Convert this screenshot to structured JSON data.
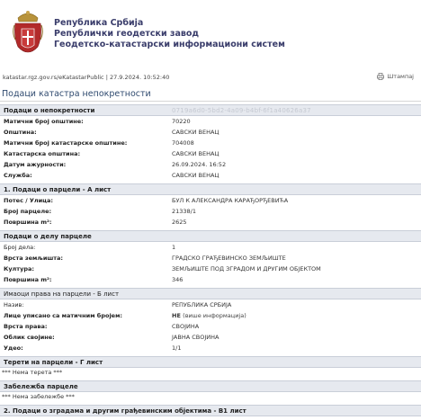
{
  "header": {
    "lines": [
      "Република Србија",
      "Републички геодетски завод",
      "Геодетско-катастарски информациони систем"
    ]
  },
  "urlbar": {
    "text": "katastar.rgz.gov.rs/eKatastarPublic | 27.9.2024. 10:52:40",
    "print_label": "Штампај"
  },
  "page_title": "Подаци катастра непокретности",
  "property": {
    "header": "Подаци о непокретности",
    "guid": "0719a6d0-5bd2-4a09-b4bf-6f1a40626a37",
    "rows": [
      {
        "k": "Матични број општине:",
        "v": "70220"
      },
      {
        "k": "Општина:",
        "v": "САВСКИ ВЕНАЦ"
      },
      {
        "k": "Матични број катастарске општине:",
        "v": "704008"
      },
      {
        "k": "Катастарска општина:",
        "v": "САВСКИ ВЕНАЦ"
      },
      {
        "k": "Датум ажурности:",
        "v": "26.09.2024. 16:52"
      },
      {
        "k": "Служба:",
        "v": "САВСКИ ВЕНАЦ"
      }
    ]
  },
  "parcel": {
    "header": "1. Подаци о парцели - А лист",
    "rows": [
      {
        "k": "Потес / Улица:",
        "v": "БУЛ К АЛЕКСАНДРА КАРАЂОРЂЕВИЋА"
      },
      {
        "k": "Број парцеле:",
        "v": "21338/1"
      },
      {
        "k": "Површина m²:",
        "v": "2625"
      }
    ]
  },
  "part": {
    "header": "Подаци о делу парцеле",
    "rows": [
      {
        "k": "Број дела:",
        "v": "1"
      },
      {
        "k": "Врста земљишта:",
        "v": "ГРАДСКО ГРАЂЕВИНСКО ЗЕМЉИШТЕ"
      },
      {
        "k": "Култура:",
        "v": "ЗЕМЉИШТЕ ПОД ЗГРАДОМ И ДРУГИМ ОБЈЕКТОМ"
      },
      {
        "k": "Површина m²:",
        "v": "346"
      }
    ]
  },
  "owners": {
    "header": "Имаоци права на парцели - Б лист",
    "rows": [
      {
        "k": "Назив:",
        "v": "РЕПУБЛИКА СРБИЈА"
      },
      {
        "k": "Лице уписано са матичним бројем:",
        "v_main": "НЕ",
        "v_more": "(више информација)"
      },
      {
        "k": "Врста права:",
        "v": "СВОЈИНА"
      },
      {
        "k": "Облик својине:",
        "v": "ЈАВНА СВОЈИНА"
      },
      {
        "k": "Удео:",
        "v": "1/1"
      }
    ]
  },
  "burdens": {
    "header": "Терети на парцели - Г лист",
    "note": "*** Нема терета ***"
  },
  "remark": {
    "header": "Забележба парцеле",
    "note": "*** Нема забележбе ***"
  },
  "buildings": {
    "header": "2. Подаци о зградама и другим грађевинским објектима - В1 лист"
  },
  "colors": {
    "title": "#2f4a6f",
    "section_bg": "#e6e9ef",
    "warning_red": "#c22222",
    "org_text": "#3a3d6b"
  },
  "icons": {
    "crest": "serbian-coat-of-arms-icon",
    "print": "printer-icon"
  }
}
